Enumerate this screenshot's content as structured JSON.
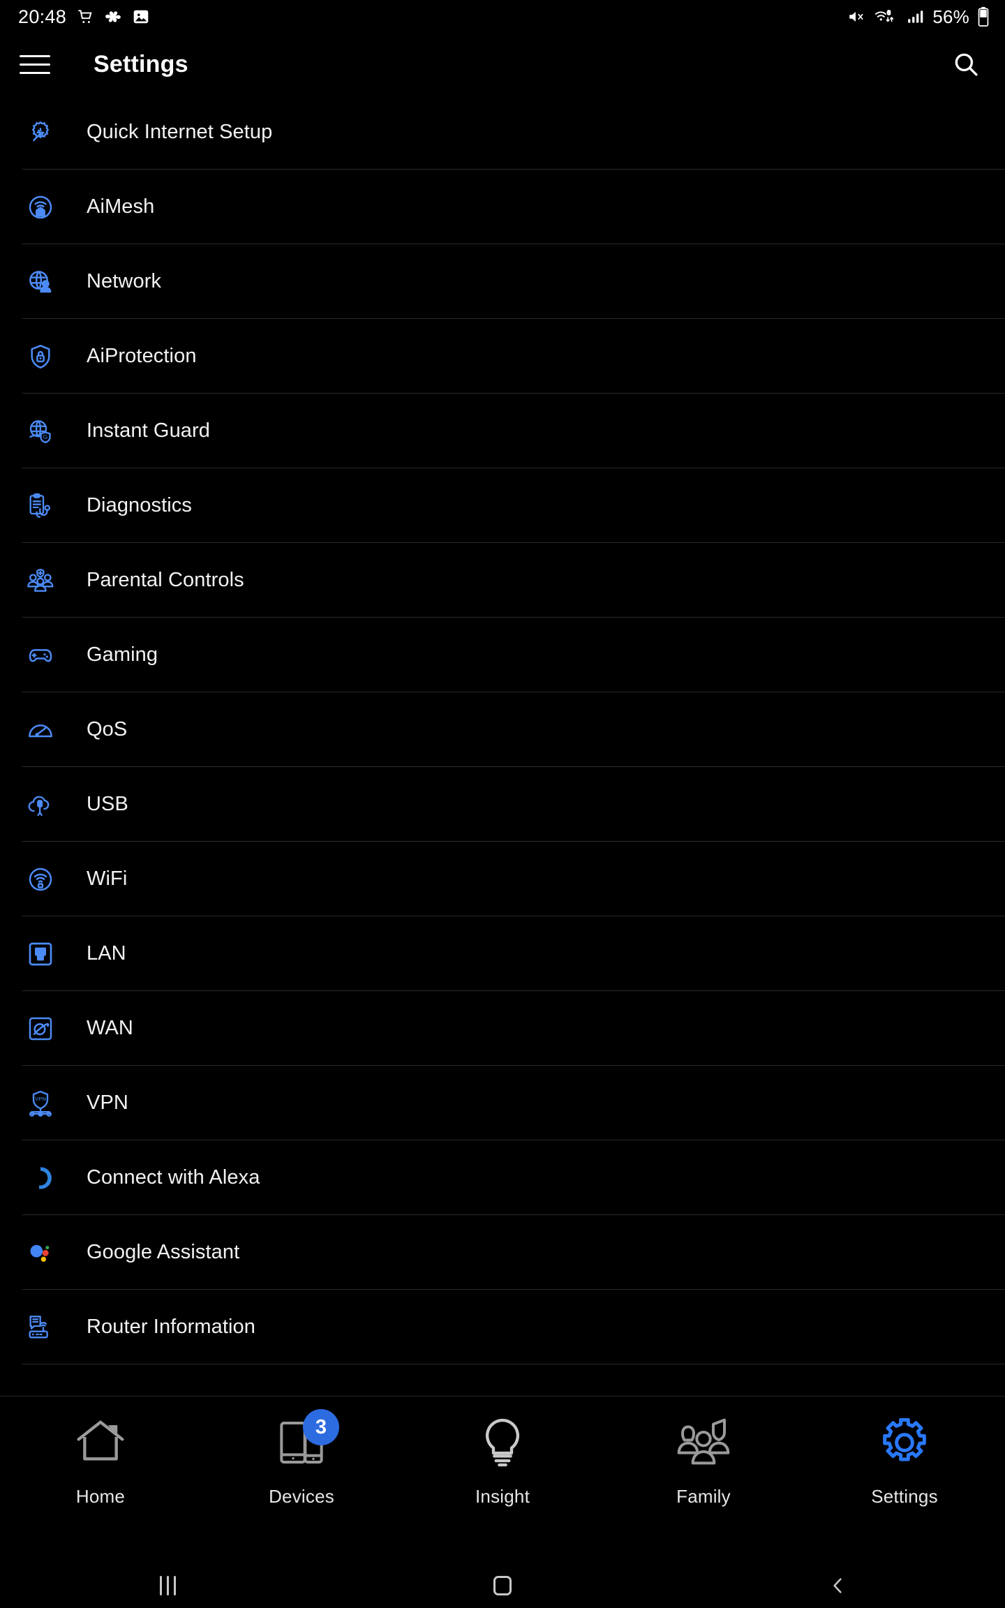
{
  "statusbar": {
    "time": "20:48",
    "battery": "56%",
    "left_icons": [
      "shopping-cart-icon",
      "pinwheel-icon",
      "image-icon"
    ],
    "right_icons": [
      "mute-icon",
      "wifi6-data-icon",
      "signal-bars-icon",
      "battery-icon"
    ]
  },
  "appbar": {
    "menu_icon": "hamburger-menu-icon",
    "title": "Settings",
    "search_icon": "search-icon"
  },
  "settings_list": [
    {
      "label": "Quick Internet Setup",
      "icon": "gear-wand-icon"
    },
    {
      "label": "AiMesh",
      "icon": "mesh-home-wifi-icon"
    },
    {
      "label": "Network",
      "icon": "globe-user-icon"
    },
    {
      "label": "AiProtection",
      "icon": "shield-lock-icon"
    },
    {
      "label": "Instant Guard",
      "icon": "globe-guard-icon"
    },
    {
      "label": "Diagnostics",
      "icon": "clipboard-stethoscope-icon"
    },
    {
      "label": "Parental Controls",
      "icon": "family-group-icon"
    },
    {
      "label": "Gaming",
      "icon": "gamepad-icon"
    },
    {
      "label": "QoS",
      "icon": "speedometer-icon"
    },
    {
      "label": "USB",
      "icon": "cloud-usb-icon"
    },
    {
      "label": "WiFi",
      "icon": "wifi-circle-icon"
    },
    {
      "label": "LAN",
      "icon": "ethernet-port-icon"
    },
    {
      "label": "WAN",
      "icon": "globe-orbit-icon"
    },
    {
      "label": "VPN",
      "icon": "vpn-shield-icon"
    },
    {
      "label": "Connect with Alexa",
      "icon": "alexa-ring-icon"
    },
    {
      "label": "Google Assistant",
      "icon": "google-assistant-icon"
    },
    {
      "label": "Router Information",
      "icon": "router-info-icon"
    }
  ],
  "tabbar": [
    {
      "label": "Home",
      "icon": "house-icon",
      "badge": "",
      "active": false
    },
    {
      "label": "Devices",
      "icon": "devices-icon",
      "badge": "3",
      "active": false
    },
    {
      "label": "Insight",
      "icon": "lightbulb-icon",
      "badge": "",
      "active": false
    },
    {
      "label": "Family",
      "icon": "people-group-icon",
      "badge": "",
      "active": false
    },
    {
      "label": "Settings",
      "icon": "gear-icon",
      "badge": "",
      "active": true
    }
  ],
  "navbar": {
    "recents": "recents-icon",
    "home": "home-icon",
    "back": "back-icon"
  },
  "colors": {
    "background": "#000000",
    "icon_blue": "#4c8bf5",
    "accent_blue": "#2979ff",
    "badge_blue": "#2d6be0",
    "text": "#f2f2f2",
    "divider": "#2a2a2a",
    "inactive_tab": "#9a9a9a"
  }
}
